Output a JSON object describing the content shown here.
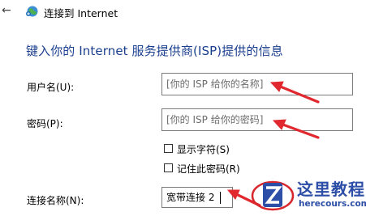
{
  "window": {
    "title": "连接到 Internet"
  },
  "heading": "键入你的 Internet 服务提供商(ISP)提供的信息",
  "form": {
    "username": {
      "label": "用户名(U):",
      "placeholder": "[你的 ISP 给你的名称]"
    },
    "password": {
      "label": "密码(P):",
      "placeholder": "[你的 ISP 给你的密码]"
    },
    "show_chars": {
      "label": "显示字符(S)",
      "checked": false
    },
    "remember_password": {
      "label": "记住此密码(R)",
      "checked": false
    },
    "connection_name": {
      "label": "连接名称(N):",
      "value": "宽带连接 2"
    }
  },
  "watermark": {
    "text": "这里教程网",
    "url": "herecours.com"
  },
  "colors": {
    "heading": "#1b3f8f",
    "arrow": "#e0282e",
    "watermark": "#2d4ea6"
  },
  "icons": [
    "back-arrow-icon",
    "network-globe-icon",
    "checkbox-icon",
    "red-arrow-icon"
  ]
}
